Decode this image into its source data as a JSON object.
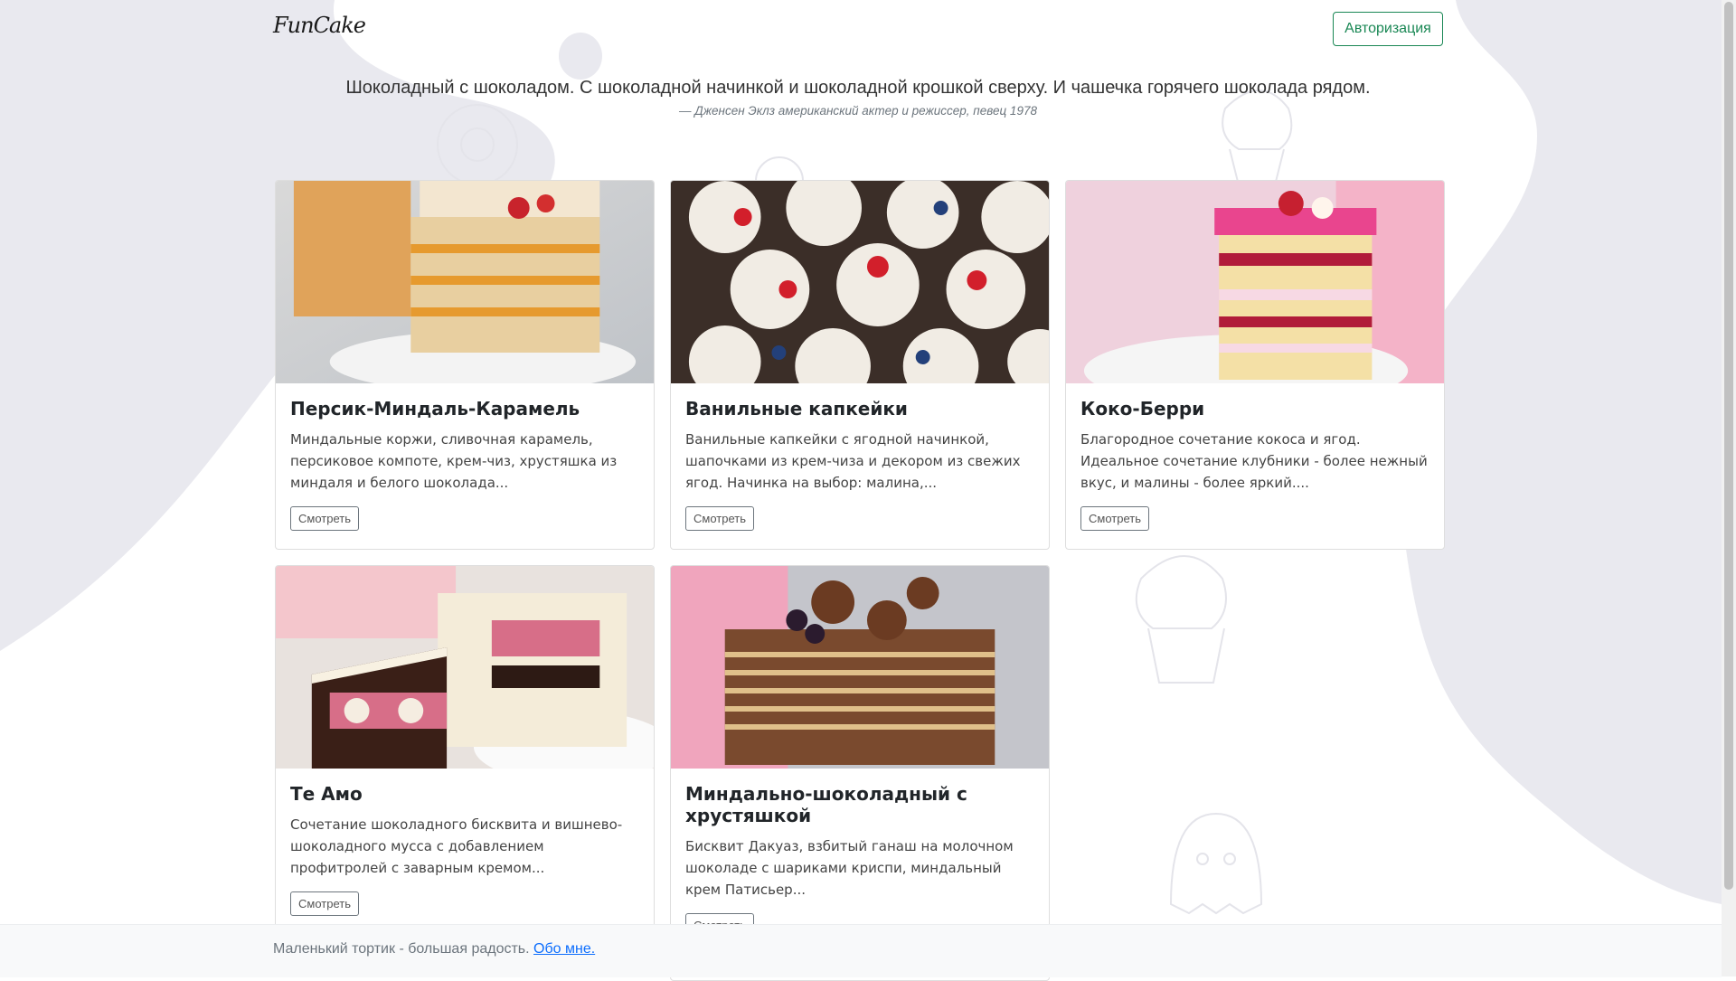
{
  "header": {
    "brand": "FunCake",
    "auth_button": "Авторизация"
  },
  "quote": {
    "text": "Шоколадный с шоколадом. С шоколадной начинкой и шоколадной крошкой сверху. И чашечка горячего шоколада рядом.",
    "author": "— Дженсен Эклз американский актер и режиссер, певец 1978"
  },
  "products": [
    {
      "title": "Персик-Миндаль-Карамель",
      "description": "Миндальные коржи, сливочная карамель, персиковое компоте, крем-чиз, хрустяшка из миндаля и белого шоколада...",
      "button": "Смотреть"
    },
    {
      "title": "Ванильные капкейки",
      "description": "Ванильные капкейки с ягодной начинкой, шапочками из крем-чиза и декором из свежих ягод. Начинка на выбор: малина,...",
      "button": "Смотреть"
    },
    {
      "title": "Коко-Берри",
      "description": "Благородное сочетание кокоса и ягод. Идеальное сочетание клубники - более нежный вкус, и малины - более яркий....",
      "button": "Смотреть"
    },
    {
      "title": "Те Амо",
      "description": "Сочетание шоколадного бисквита и вишнево-шоколадного мусса с добавлением профитролей с заварным кремом...",
      "button": "Смотреть"
    },
    {
      "title": "Миндально-шоколадный с хрустяшкой",
      "description": "Бисквит Дакуаз, взбитый ганаш на молочном шоколаде с шариками криспи, миндальный крем Патисьер...",
      "button": "Смотреть"
    }
  ],
  "footer": {
    "text": "Маленький тортик - большая радость.",
    "link": "Обо мне."
  },
  "colors": {
    "accent": "#198754",
    "link": "#0d6efd",
    "blob": "#e9e9ef"
  }
}
